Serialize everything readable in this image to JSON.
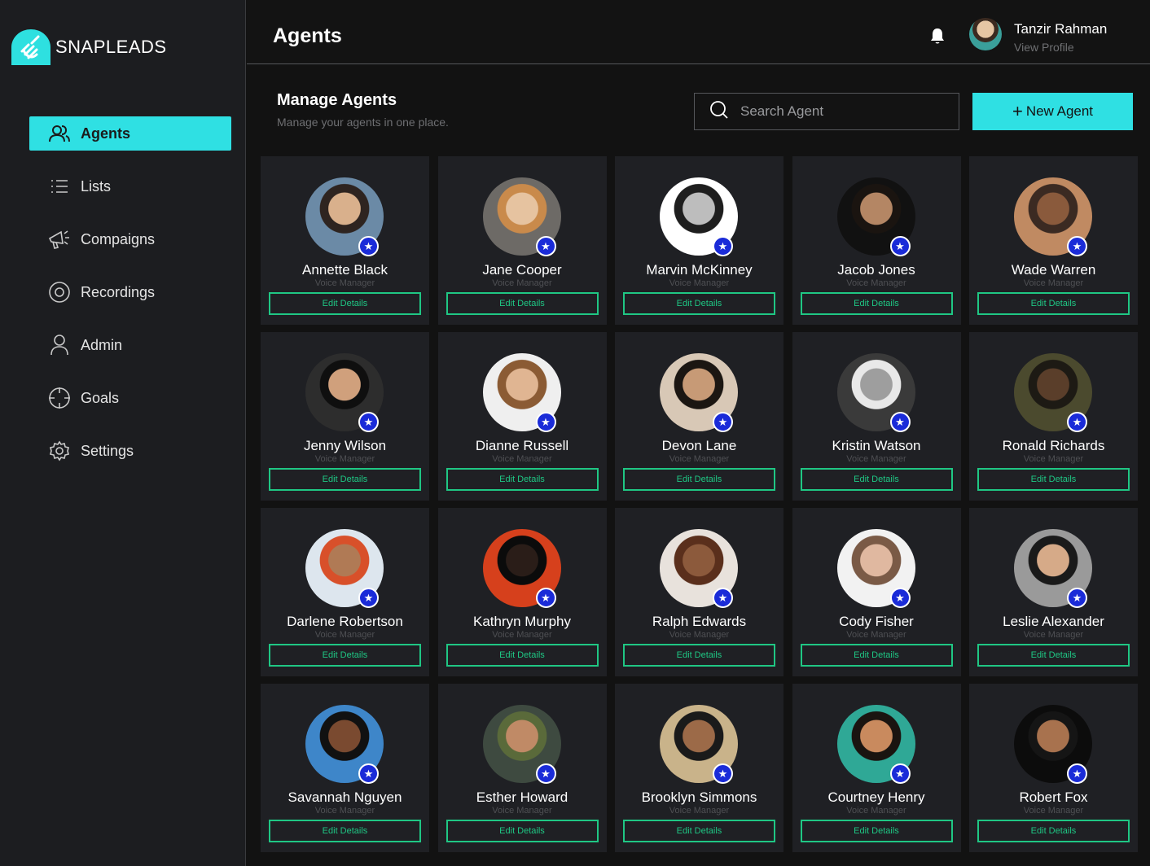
{
  "brand": {
    "name": "SNAPLEADS",
    "logo_icon": "hand-logo-icon",
    "accent": "#2fe0e3"
  },
  "sidebar": {
    "items": [
      {
        "label": "Agents",
        "icon": "users-icon",
        "active": true
      },
      {
        "label": "Lists",
        "icon": "list-icon",
        "active": false
      },
      {
        "label": "Compaigns",
        "icon": "megaphone-icon",
        "active": false
      },
      {
        "label": "Recordings",
        "icon": "record-icon",
        "active": false
      },
      {
        "label": "Admin",
        "icon": "user-icon",
        "active": false
      },
      {
        "label": "Goals",
        "icon": "target-icon",
        "active": false
      },
      {
        "label": "Settings",
        "icon": "gear-icon",
        "active": false
      }
    ]
  },
  "header": {
    "title": "Agents",
    "user": {
      "name": "Tanzir Rahman",
      "link": "View Profile"
    }
  },
  "toolbar": {
    "title": "Manage Agents",
    "subtitle": "Manage your agents in one place.",
    "search_placeholder": "Search Agent",
    "new_button": "New Agent"
  },
  "agents": [
    {
      "name": "Annette Black",
      "role": "Voice Manager",
      "action": "Edit Details",
      "photo": [
        "#d9b08c",
        "#2e2420",
        "#6b8aa6"
      ]
    },
    {
      "name": "Jane Cooper",
      "role": "Voice Manager",
      "action": "Edit Details",
      "photo": [
        "#e6c3a0",
        "#c98a4b",
        "#6d6a66"
      ]
    },
    {
      "name": "Marvin McKinney",
      "role": "Voice Manager",
      "action": "Edit Details",
      "photo": [
        "#bdbdbd",
        "#1e1e1e",
        "#ffffff"
      ]
    },
    {
      "name": "Jacob Jones",
      "role": "Voice Manager",
      "action": "Edit Details",
      "photo": [
        "#b48664",
        "#1a1410",
        "#111111"
      ]
    },
    {
      "name": "Wade Warren",
      "role": "Voice Manager",
      "action": "Edit Details",
      "photo": [
        "#8a5a3c",
        "#3b2a22",
        "#c08a62"
      ]
    },
    {
      "name": "Jenny Wilson",
      "role": "Voice Manager",
      "action": "Edit Details",
      "photo": [
        "#d0a07c",
        "#0f0f0f",
        "#2d2d2d"
      ]
    },
    {
      "name": "Dianne Russell",
      "role": "Voice Manager",
      "action": "Edit Details",
      "photo": [
        "#e0b592",
        "#8b5b34",
        "#efefef"
      ]
    },
    {
      "name": "Devon Lane",
      "role": "Voice Manager",
      "action": "Edit Details",
      "photo": [
        "#c79a76",
        "#1b1612",
        "#d8c8b6"
      ]
    },
    {
      "name": "Kristin Watson",
      "role": "Voice Manager",
      "action": "Edit Details",
      "photo": [
        "#9e9e9e",
        "#e8e8e8",
        "#3a3a3a"
      ]
    },
    {
      "name": "Ronald Richards",
      "role": "Voice Manager",
      "action": "Edit Details",
      "photo": [
        "#5a3e2a",
        "#1d1a14",
        "#4b4a2e"
      ]
    },
    {
      "name": "Darlene Robertson",
      "role": "Voice Manager",
      "action": "Edit Details",
      "photo": [
        "#b07a55",
        "#d8502a",
        "#dde6ee"
      ]
    },
    {
      "name": "Kathryn Murphy",
      "role": "Voice Manager",
      "action": "Edit Details",
      "photo": [
        "#2a1d18",
        "#0b0b0b",
        "#d6401c"
      ]
    },
    {
      "name": "Ralph Edwards",
      "role": "Voice Manager",
      "action": "Edit Details",
      "photo": [
        "#8c5a3c",
        "#5a2f1c",
        "#e8e2dc"
      ]
    },
    {
      "name": "Cody Fisher",
      "role": "Voice Manager",
      "action": "Edit Details",
      "photo": [
        "#e0b8a0",
        "#7a5a46",
        "#f2f2f2"
      ]
    },
    {
      "name": "Leslie Alexander",
      "role": "Voice Manager",
      "action": "Edit Details",
      "photo": [
        "#d6aa88",
        "#1a1a1a",
        "#9a9a9a"
      ]
    },
    {
      "name": "Savannah Nguyen",
      "role": "Voice Manager",
      "action": "Edit Details",
      "photo": [
        "#7a4a30",
        "#111111",
        "#3e86c9"
      ]
    },
    {
      "name": "Esther Howard",
      "role": "Voice Manager",
      "action": "Edit Details",
      "photo": [
        "#c08a66",
        "#5a6a3a",
        "#3e4a40"
      ]
    },
    {
      "name": "Brooklyn Simmons",
      "role": "Voice Manager",
      "action": "Edit Details",
      "photo": [
        "#9c6a48",
        "#1a1a1a",
        "#c9b38a"
      ]
    },
    {
      "name": "Courtney Henry",
      "role": "Voice Manager",
      "action": "Edit Details",
      "photo": [
        "#c98a5e",
        "#1a1410",
        "#2fa896"
      ]
    },
    {
      "name": "Robert Fox",
      "role": "Voice Manager",
      "action": "Edit Details",
      "photo": [
        "#a8724e",
        "#151515",
        "#0c0c0c"
      ]
    }
  ]
}
